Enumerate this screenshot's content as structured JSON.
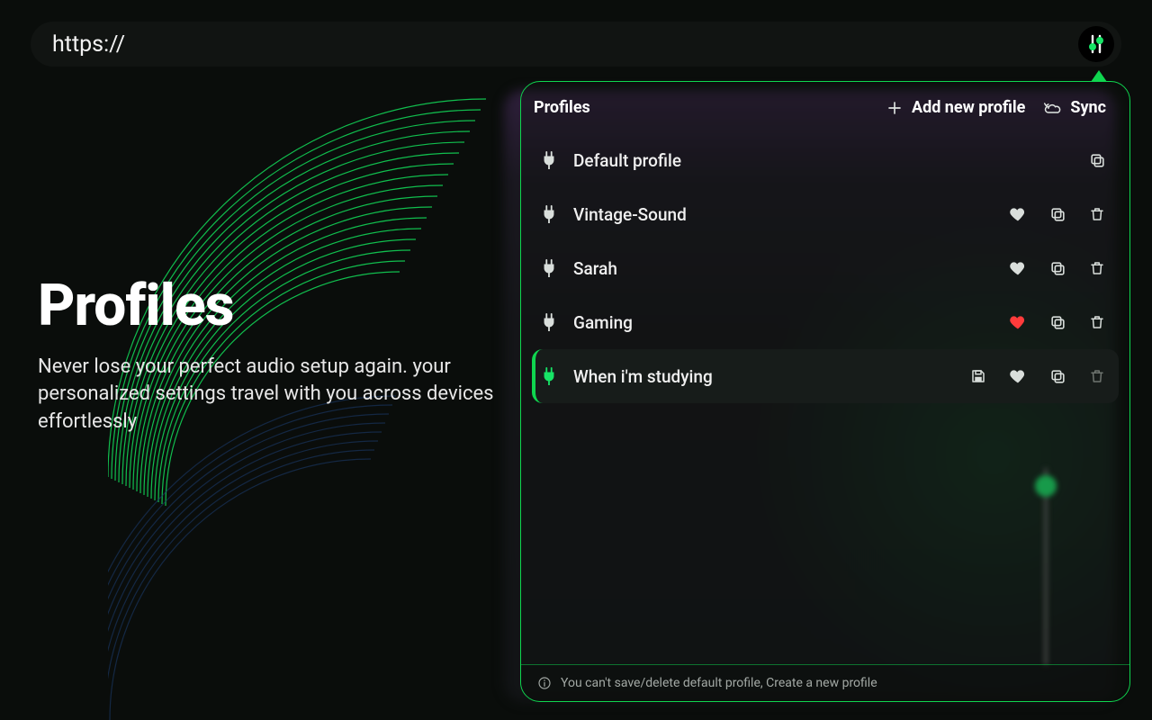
{
  "address": "https://",
  "hero": {
    "title": "Profiles",
    "subtitle": "Never lose your perfect audio setup again. your personalized settings travel with you across devices effortlessly"
  },
  "panel": {
    "title": "Profiles",
    "addLabel": "Add new profile",
    "syncLabel": "Sync",
    "footer": "You can't save/delete default profile, Create a new profile",
    "profiles": [
      {
        "name": "Default profile",
        "active": false,
        "fav": false,
        "favColor": "#d9dedb",
        "canSave": false,
        "canFav": false,
        "canCopy": true,
        "canDelete": false
      },
      {
        "name": "Vintage-Sound",
        "active": false,
        "fav": false,
        "favColor": "#d9dedb",
        "canSave": false,
        "canFav": true,
        "canCopy": true,
        "canDelete": true
      },
      {
        "name": "Sarah",
        "active": false,
        "fav": false,
        "favColor": "#d9dedb",
        "canSave": false,
        "canFav": true,
        "canCopy": true,
        "canDelete": true
      },
      {
        "name": "Gaming",
        "active": false,
        "fav": true,
        "favColor": "#ff3b3b",
        "canSave": false,
        "canFav": true,
        "canCopy": true,
        "canDelete": true
      },
      {
        "name": "When i'm studying",
        "active": true,
        "fav": false,
        "favColor": "#d9dedb",
        "canSave": true,
        "canFav": true,
        "canCopy": true,
        "canDelete": true
      }
    ]
  },
  "colors": {
    "accent": "#0fd64f",
    "heart": "#ff3b3b"
  }
}
